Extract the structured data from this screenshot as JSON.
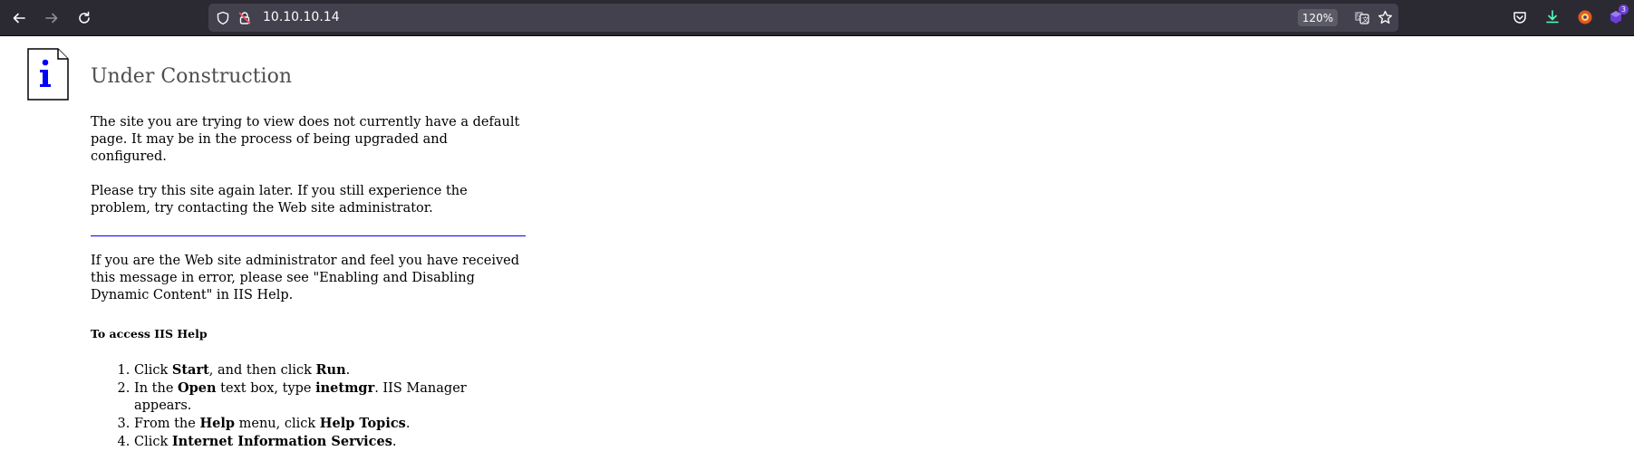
{
  "browser": {
    "url": "10.10.10.14",
    "zoom": "120%",
    "extension_badge_count": "3"
  },
  "page": {
    "title": "Under Construction",
    "para1": "The site you are trying to view does not currently have a default page. It may be in the process of being upgraded and configured.",
    "para2": "Please try this site again later. If you still experience the problem, try contacting the Web site administrator.",
    "para3": "If you are the Web site administrator and feel you have received this message in error, please see \"Enabling and Disabling Dynamic Content\" in IIS Help.",
    "help_heading": "To access IIS Help",
    "steps": [
      {
        "a": "Click ",
        "b1": "Start",
        "c": ", and then click ",
        "b2": "Run",
        "d": "."
      },
      {
        "a": "In the ",
        "b1": "Open",
        "c": " text box, type ",
        "b2": "inetmgr",
        "d": ". IIS Manager appears."
      },
      {
        "a": "From the ",
        "b1": "Help",
        "c": " menu, click ",
        "b2": "Help Topics",
        "d": "."
      },
      {
        "a": "Click ",
        "b1": "Internet Information Services",
        "c": ".",
        "b2": "",
        "d": ""
      }
    ]
  }
}
